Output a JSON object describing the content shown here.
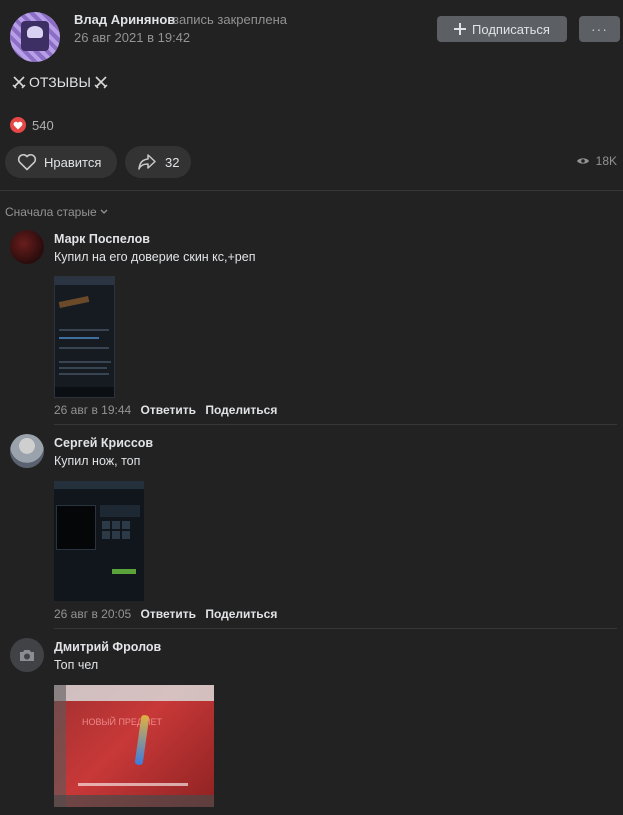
{
  "post": {
    "author": "Влад Аринянов",
    "pinned_note": "запись закреплена",
    "date": "26 авг 2021 в 19:42",
    "subscribe_label": "Подписаться",
    "more_label": "···",
    "text": "ОТЗЫВЫ",
    "reactions_count": "540",
    "like_label": "Нравится",
    "shares_count": "32",
    "views_count": "18K"
  },
  "comments_sort": "Сначала старые",
  "comments": [
    {
      "author": "Марк Поспелов",
      "text": "Купил на его доверие скин кс,+реп",
      "date": "26 авг в 19:44",
      "reply_label": "Ответить",
      "share_label": "Поделиться"
    },
    {
      "author": "Сергей Криссов",
      "text": "Купил нож, топ",
      "date": "26 авг в 20:05",
      "reply_label": "Ответить",
      "share_label": "Поделиться"
    },
    {
      "author": "Дмитрий Фролов",
      "text": "Топ чел",
      "attachment_text": "НОВЫЙ ПРЕДМЕТ"
    }
  ],
  "colors": {
    "background": "#222222",
    "button": "#5c5f63",
    "pill": "#333333",
    "heart": "#e64646"
  },
  "icons": [
    "plus-icon",
    "more-icon",
    "crossed-swords-icon",
    "heart-icon",
    "share-arrow-icon",
    "eye-icon",
    "chevron-down-icon",
    "camera-icon"
  ]
}
